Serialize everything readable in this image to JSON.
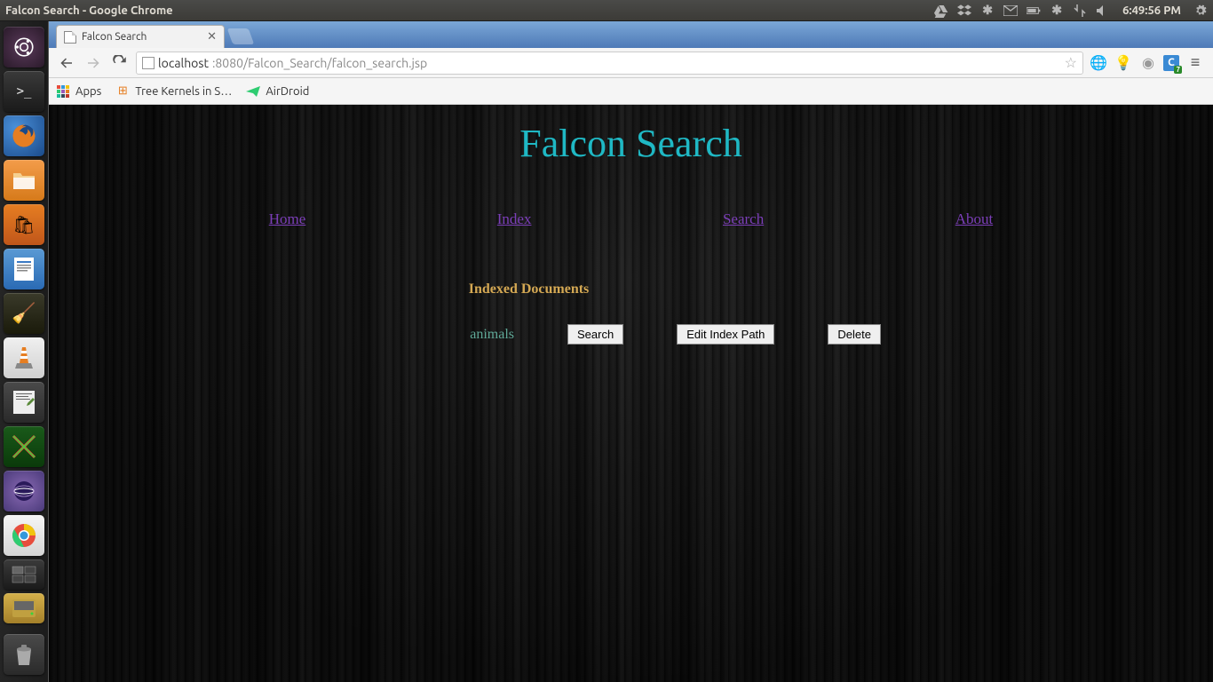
{
  "os": {
    "window_title": "Falcon Search - Google Chrome",
    "clock": "6:49:56 PM"
  },
  "browser": {
    "tab_title": "Falcon Search",
    "url_prefix": "localhost",
    "url_rest": ":8080/Falcon_Search/falcon_search.jsp",
    "bookmarks": {
      "apps": "Apps",
      "tree_kernels": "Tree Kernels in S…",
      "airdroid": "AirDroid"
    }
  },
  "page": {
    "title": "Falcon Search",
    "nav": {
      "home": "Home",
      "index": "Index",
      "search": "Search",
      "about": "About"
    },
    "section_heading": "Indexed Documents",
    "doc": {
      "name": "animals",
      "btn_search": "Search",
      "btn_edit": "Edit Index Path",
      "btn_delete": "Delete"
    }
  }
}
